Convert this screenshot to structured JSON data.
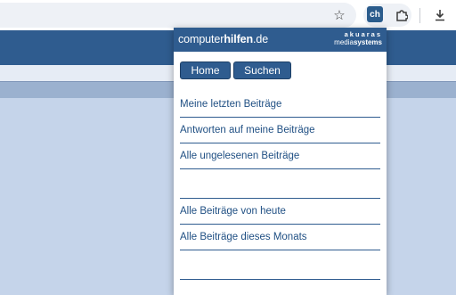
{
  "browser": {
    "star_icon": "star-icon",
    "extension_label": "ch",
    "puzzle_icon": "puzzle-icon",
    "download_icon": "download-icon"
  },
  "popup": {
    "brand_prefix": "computer",
    "brand_bold": "hilfen",
    "brand_suffix": ".de",
    "company_line1": "akuaras",
    "company_line2_a": "media",
    "company_line2_b": "systems",
    "buttons": [
      "Home",
      "Suchen"
    ],
    "links": [
      "Meine letzten Beiträge",
      "Antworten auf meine Beiträge",
      "Alle ungelesenen Beiträge",
      "",
      "Alle Beiträge von heute",
      "Alle Beiträge dieses Monats",
      ""
    ]
  },
  "colors": {
    "brand_blue": "#2f5c8f",
    "link_blue": "#1f4f83",
    "page_background": "#c5d4ea"
  }
}
